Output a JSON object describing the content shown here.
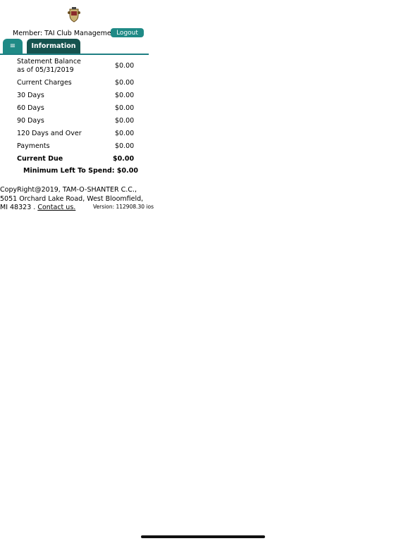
{
  "header": {
    "member_label": "Member: TAI Club Management",
    "logout_label": "Logout"
  },
  "nav": {
    "menu_icon": "≡",
    "info_tab_label": "Information"
  },
  "statement": {
    "rows": [
      {
        "label": "Statement Balance",
        "label2": "as of 05/31/2019",
        "amount": "$0.00"
      },
      {
        "label": "Current Charges",
        "amount": "$0.00"
      },
      {
        "label": "30 Days",
        "amount": "$0.00"
      },
      {
        "label": "60 Days",
        "amount": "$0.00"
      },
      {
        "label": "90 Days",
        "amount": "$0.00"
      },
      {
        "label": "120 Days and Over",
        "amount": "$0.00"
      },
      {
        "label": "Payments",
        "amount": "$0.00"
      },
      {
        "label": "Current Due",
        "amount": "$0.00"
      }
    ],
    "min_spend": "Minimum Left To Spend: $0.00"
  },
  "footer": {
    "line1": "CopyRight@2019, TAM-O-SHANTER C.C.,",
    "line2": "5051 Orchard Lake Road, West Bloomfield,",
    "line3_prefix": "MI 48323 .",
    "contact_link": "Contact us.",
    "version": "Version: 112908.30 ios"
  },
  "colors": {
    "accent": "#1f8a86",
    "tab_dark": "#16534f",
    "rule": "#1f7f83"
  },
  "icons": [
    "club-crest-logo",
    "hamburger-menu-icon"
  ]
}
